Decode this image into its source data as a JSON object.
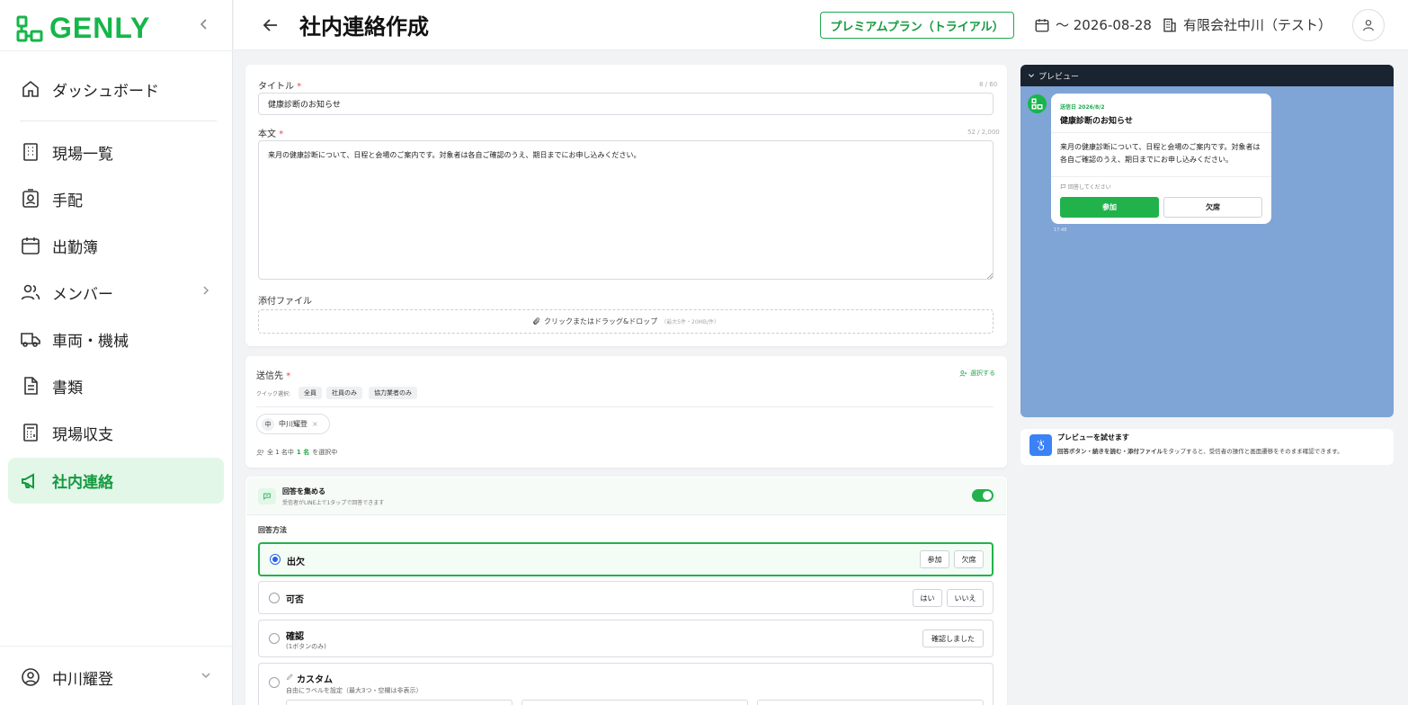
{
  "app": {
    "logo_text": "GENLY"
  },
  "sidebar": {
    "items": [
      {
        "label": "ダッシュボード",
        "icon": "home-icon"
      },
      {
        "label": "現場一覧",
        "icon": "building-icon"
      },
      {
        "label": "手配",
        "icon": "id-badge-icon"
      },
      {
        "label": "出勤簿",
        "icon": "calendar-icon"
      },
      {
        "label": "メンバー",
        "icon": "users-icon"
      },
      {
        "label": "車両・機械",
        "icon": "truck-icon"
      },
      {
        "label": "書類",
        "icon": "document-icon"
      },
      {
        "label": "現場収支",
        "icon": "calculator-icon"
      },
      {
        "label": "社内連絡",
        "icon": "megaphone-icon",
        "active": true
      }
    ],
    "user": {
      "name": "中川耀登"
    }
  },
  "header": {
    "title": "社内連絡作成",
    "plan_badge": "プレミアムプラン（トライアル）",
    "plan_until": "〜 2026-08-28",
    "company": "有限会社中川（テスト）"
  },
  "form": {
    "title_label": "タイトル",
    "title_count": "8 / 60",
    "title_value": "健康診断のお知らせ",
    "body_label": "本文",
    "body_count": "52 / 2,000",
    "body_value": "来月の健康診断について、日程と会場のご案内です。対象者は各自ご確認のうえ、期日までにお申し込みください。",
    "attach_label": "添付ファイル",
    "attach_text": "クリックまたはドラッグ&ドロップ",
    "attach_hint": "（最大5件・20MB/件）"
  },
  "recipients": {
    "label": "送信先",
    "select_link": "選択する",
    "quick_label": "クイック選択:",
    "quick_chips": [
      "全員",
      "社員のみ",
      "協力業者のみ"
    ],
    "selected_avatar": "中",
    "selected_name": "中川耀登",
    "summary_prefix": "全 1 名中",
    "summary_count": "1 名",
    "summary_suffix": "を選択中"
  },
  "answers": {
    "title": "回答を集める",
    "subtitle": "受信者がLINE上で1タップで回答できます",
    "enabled": true,
    "method_label": "回答方法",
    "options": [
      {
        "title": "出欠",
        "buttons": [
          "参加",
          "欠席"
        ],
        "selected": true
      },
      {
        "title": "可否",
        "buttons": [
          "はい",
          "いいえ"
        ],
        "selected": false
      },
      {
        "title": "確認",
        "sub": "(1ボタンのみ)",
        "buttons": [
          "確認しました"
        ],
        "selected": false
      },
      {
        "title": "カスタム",
        "sub": "自由にラベルを設定（最大3つ・空欄は非表示）",
        "selected": false
      }
    ]
  },
  "preview": {
    "header": "プレビュー",
    "date": "送信日 2026/8/2",
    "title": "健康診断のお知らせ",
    "body": "来月の健康診断について、日程と会場のご案内です。対象者は各自ご確認のうえ、期日までにお申し込みください。",
    "reply_hint": "回答してください",
    "btn_yes": "参加",
    "btn_no": "欠席",
    "time": "17:48"
  },
  "tip": {
    "title": "プレビューを試せます",
    "body_bold": "回答ボタン・続きを読む・添付ファイル",
    "body_rest": "をタップすると、受信者の操作と画面遷移をそのまま確認できます。"
  },
  "colors": {
    "brand": "#15b64a",
    "active_bg": "#e2f7e8",
    "preview_bg": "#7fa4d6"
  }
}
